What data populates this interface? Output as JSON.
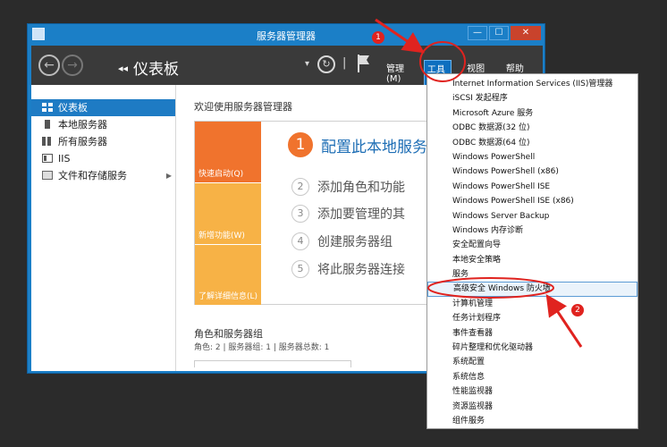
{
  "window": {
    "title": "服务器管理器",
    "controls": {
      "minimize": "—",
      "maximize": "☐",
      "close": "✕"
    }
  },
  "toolbar": {
    "back_icon": "←",
    "forward_icon": "→",
    "breadcrumb_arrows": "◂◂",
    "breadcrumb": "仪表板",
    "dropdown_caret": "▾",
    "refresh_icon": "↻",
    "separator": "|",
    "menus": [
      {
        "label": "管理(M)"
      },
      {
        "label": "工具(T)"
      },
      {
        "label": "视图(V)"
      },
      {
        "label": "帮助(H)"
      }
    ]
  },
  "sidebar": {
    "items": [
      {
        "label": "仪表板",
        "icon": "dashboard-icon"
      },
      {
        "label": "本地服务器",
        "icon": "server-icon"
      },
      {
        "label": "所有服务器",
        "icon": "servers-icon"
      },
      {
        "label": "IIS",
        "icon": "iis-icon"
      },
      {
        "label": "文件和存储服务",
        "icon": "storage-icon",
        "has_submenu": true
      }
    ],
    "submenu_arrow": "▶"
  },
  "main": {
    "welcome": "欢迎使用服务器管理器",
    "tiles": [
      "快速启动(Q)",
      "新增功能(W)",
      "了解详细信息(L)"
    ],
    "steps": [
      {
        "num": "1",
        "text": "配置此本地服务"
      },
      {
        "num": "2",
        "text": "添加角色和功能"
      },
      {
        "num": "3",
        "text": "添加要管理的其"
      },
      {
        "num": "4",
        "text": "创建服务器组"
      },
      {
        "num": "5",
        "text": "将此服务器连接"
      }
    ],
    "roles_title": "角色和服务器组",
    "roles_sub": "角色: 2 | 服务器组: 1 | 服务器总数: 1"
  },
  "tools_menu": [
    "Internet Information Services (IIS)管理器",
    "iSCSI 发起程序",
    "Microsoft Azure 服务",
    "ODBC 数据源(32 位)",
    "ODBC 数据源(64 位)",
    "Windows PowerShell",
    "Windows PowerShell (x86)",
    "Windows PowerShell ISE",
    "Windows PowerShell ISE (x86)",
    "Windows Server Backup",
    "Windows 内存诊断",
    "安全配置向导",
    "本地安全策略",
    "服务",
    "高级安全 Windows 防火墙",
    "计算机管理",
    "任务计划程序",
    "事件查看器",
    "碎片整理和优化驱动器",
    "系统配置",
    "系统信息",
    "性能监视器",
    "资源监视器",
    "组件服务"
  ],
  "annotations": {
    "badge1": "1",
    "badge2": "2"
  },
  "colors": {
    "accent": "#1e7bc4",
    "tile_orange": "#f0732d",
    "tile_yellow": "#f7b246",
    "annotation_red": "#e0231f"
  }
}
